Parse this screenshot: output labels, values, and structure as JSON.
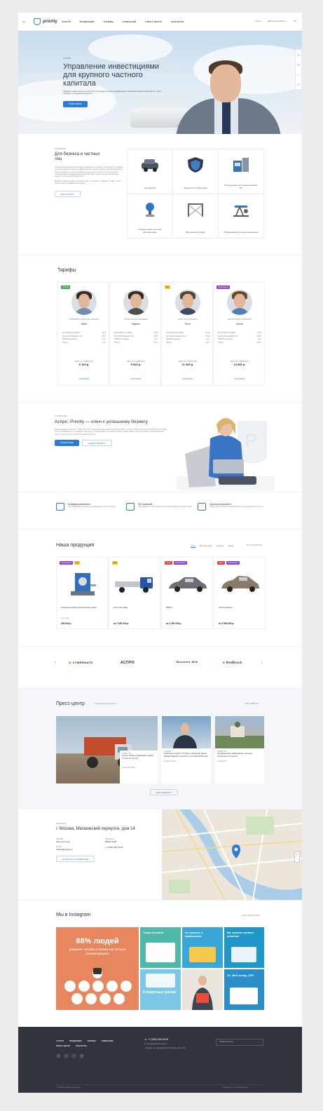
{
  "header": {
    "lang": "ДП",
    "logo_text": "priority",
    "nav": [
      "УСЛУГИ",
      "ПРОДУКЦИЯ",
      "ТАРИФЫ",
      "КОМПАНИЯ",
      "ПРЕСС-ЦЕНТР",
      "КОНТАКТЫ"
    ],
    "search_label": "Поиск",
    "account_label": "Личный кабинет",
    "cart_count": "0"
  },
  "hero": {
    "kicker": "АКТИВЫ",
    "title": "Управление инвестициями для крупного частного капитала",
    "text": "Подберем инвестиционную стратегию для каждого клиента индивидуально. Поможем вложить средства так, чтобы сохранить и приумножить капитал.",
    "button": "ПОДРОБНЕЕ"
  },
  "corporate": {
    "kicker": "ПРОДУКЦИЯ",
    "title": "Для бизнеса и частных лиц",
    "p1": "Предлагаем широкий ассортимент продукции, которая в совокупности с нашими услугами поможет повысить эффективность вашего бизнеса, автоматизировать бизнес-процессы и улучшить качество продукции. И для тех, кто в бизнесе заинтересован в эффективном автомобильном транспорте мы предлагаем модели с расширенной гарантией.",
    "p2": "Выберите свой вариант из списка ниже, а специалист свяжется с вами, чтобы помочь сделать правильный выбор.",
    "button": "ВСЕ УСЛУГИ",
    "services": [
      "Автомобили",
      "Защита в стиле Малевей",
      "Оборудование для промышленной и ПК",
      "Промышленные системы автоматизации",
      "Металлоконструкции",
      "Оборудование для нефти-газодобычи"
    ]
  },
  "tariffs": {
    "title": "Тарифы",
    "cards": [
      {
        "badge": "Новинка",
        "badge_color": "#3aa64a",
        "sub": "ЛЮБИМЫЙ ТАРИФ ДЛЯ ЖЕНЩИН",
        "name": "Лайт",
        "features": [
          [
            "Кол-во Мастер Сервис",
            "10 %"
          ],
          [
            "Кол-во Автономный услуг",
            "40 %"
          ],
          [
            "Обработка данных",
            "1 шт"
          ],
          [
            "Объем",
            "10 гб"
          ]
        ],
        "price_label": "ЦЕНА ЗА 1 ЕДИНИЦУ",
        "price": "6 100 р.",
        "cart": "В КОРЗИНУ"
      },
      {
        "badge": "",
        "badge_color": "",
        "sub": "ОПТИМАЛЬНОЕ РЕШЕНИЕ",
        "name": "Идеал",
        "features": [
          [
            "Кол-во Мастер Сервис",
            "20 %"
          ],
          [
            "Кол-во Автономный услуг",
            "60 %"
          ],
          [
            "Обработка данных",
            "2 шт"
          ],
          [
            "Объем",
            "20 гб"
          ]
        ],
        "price_label": "ЦЕНА ЗА 1 ЕДИНИЦУ",
        "price": "9 600 р.",
        "cart": "В КОРЗИНУ"
      },
      {
        "badge": "Хит",
        "badge_color": "#f2c21f",
        "sub": "ДЛЯ РОСТА БИЗНЕСА",
        "name": "Рост",
        "features": [
          [
            "Кол-во Мастер Сервис",
            "30 %"
          ],
          [
            "Кол-во Автономный услуг",
            "80 %"
          ],
          [
            "Обработка данных",
            "4 шт"
          ],
          [
            "Объем",
            "40 гб"
          ]
        ],
        "price_label": "ЦЕНА ЗА 1 ЕДИНИЦУ",
        "price": "11 400 р.",
        "cart": "В КОРЗИНУ"
      },
      {
        "badge": "Рекомендуем",
        "badge_color": "#8a3fd1",
        "sub": "ДЛЯ КРУПНЫХ КОМПАНИЙ",
        "name": "Цель",
        "features": [
          [
            "Кол-во Мастер Сервис",
            "50 %"
          ],
          [
            "Кол-во Автономный услуг",
            "100 %"
          ],
          [
            "Обработка данных",
            "8 шт"
          ],
          [
            "Объем",
            "80 гб"
          ]
        ],
        "price_label": "ЦЕНА ЗА 1 ЕДИНИЦУ",
        "price": "13 800 р.",
        "cart": "В КОРЗИНУ"
      }
    ]
  },
  "about": {
    "kicker": "О КОМПАНИИ",
    "title": "Аспро: Priority — ключ к успешному бизнесу",
    "text": "Наша компания работает с 2003 года. Мы строим решения на благо потребителей и бизнес-процессов предприятий. Мы выступаем в роли управляющего и надежного партнера, который знает, как сделать бизнес эффективнее. Мы предлагаем полный комплекс услуг и продукции для развития вашего бизнеса.",
    "btn_primary": "ПОДРОБНЕЕ",
    "btn_secondary": "ЗАДАТЬ ВОПРОС"
  },
  "advantages": [
    {
      "title": "Конфиденциальность",
      "text": "Сохраним ваши данные и не передадим третьим лицам"
    },
    {
      "title": "500 компаний",
      "text": "Нам доверяют свой бизнес более 500 компаний по всей стране"
    },
    {
      "title": "Гарантия результата",
      "text": "Гарантируем результат нашей работы и прозрачную отчетность"
    }
  ],
  "products": {
    "title": "Наша продукция",
    "tabs": [
      "Хиты",
      "Рекомендуем",
      "Новинки",
      "Акции"
    ],
    "all_link": "ВСЯ ПРОДУКЦИЯ",
    "items": [
      {
        "badges": [
          [
            "Рекомендуем",
            "#8a3fd1"
          ],
          [
            "Хит",
            "#f2c21f"
          ]
        ],
        "name": "Промышленный трубогибочный станок",
        "stock": "Под заказ",
        "price": "429 000 р."
      },
      {
        "badges": [
          [
            "Хит",
            "#f2c21f"
          ]
        ],
        "name": "Iveco New Daily",
        "stock": "",
        "price": "от 2 000 000 р."
      },
      {
        "badges": [
          [
            "Акция",
            "#e43d3d"
          ],
          [
            "Рекомендуем",
            "#8a3fd1"
          ]
        ],
        "name": "BMW 5",
        "stock": "",
        "price": "от 4 200 000 р."
      },
      {
        "badges": [
          [
            "Акция",
            "#e43d3d"
          ],
          [
            "Рекомендуем",
            "#8a3fd1"
          ]
        ],
        "name": "Porsche Macan",
        "stock": "",
        "price": "от 5 500 000 р."
      }
    ]
  },
  "brands": [
    "CYBERNATE",
    "АСПРО",
    "Business Web",
    "RedDock"
  ],
  "press": {
    "title": "Пресс-центр",
    "subscribe": "Подписаться на новости",
    "all_link": "ВСЕ НОВОСТИ",
    "items": [
      {
        "tag": "НОВОСТИ",
        "title": "Аспро: Priority привлекает Арам-ститьи в Сургуте",
        "date": "19 декабря 2017"
      },
      {
        "tag": "СТАТЬИ",
        "title": "Компания «Аспро: Priority» признана самой эффективной в отрасли по итогам 2016 года",
        "date": "12 марта 2017"
      },
      {
        "tag": "НОВОСТИ",
        "title": "Конференция «Инновации и бизнес-процессы» в Сургуте",
        "date": "4 мая 2017"
      }
    ],
    "more_button": "ВСЕ НОВОСТИ"
  },
  "contacts": {
    "kicker": "КОНТАКТЫ",
    "address": "г. Москва, Месвижский переулок, дом 14",
    "hours_label": "РЕЖИМ",
    "hours": "Круглосуточно",
    "phone_label": "ТЕЛЕФОН",
    "phone": "8(800) 2000",
    "email_label": "E-MAIL",
    "email": "foobar@priority.ru",
    "site_label": "",
    "site": "+7 (000) 000 00 00",
    "button": "НАПИСАТЬ СООБЩЕНИЕ"
  },
  "instagram": {
    "title": "Мы в Instagram",
    "link": "ВСЕ ПУБЛИКАЦИИ",
    "promo_pct": "88% людей",
    "promo_text": "доверяют онлайн-отзывам как личным рекомендациям",
    "tile2": "Точка контакта",
    "tile3": "Не лучшее, а правильное",
    "tile4": "Вы купили готовое решение",
    "tile5": "5 смертных грехов",
    "tile6": "1С, Веб-склад, CSV"
  },
  "footer": {
    "links_row1": [
      "УСЛУГИ",
      "ПРОДУКЦИЯ",
      "ТАРИФЫ",
      "КОМПАНИЯ"
    ],
    "links_row2": [
      "ПРЕСС-ЦЕНТР",
      "КОНТАКТЫ"
    ],
    "phone": "+7 (000) 000-00-00",
    "email": "no-reply@priority-demo.ru",
    "address": "Москва, ул. Пресненский 15, 8 этаж, офис 123",
    "subscribe": "ПОДПИСАТЬСЯ",
    "copyright": "© 2018 Все права защищены",
    "dev": "Разработка и сопровождение"
  },
  "colors": {
    "accent": "#2b7bd8",
    "footer_bg": "#30343b",
    "promo_bg": "#e8875f"
  }
}
